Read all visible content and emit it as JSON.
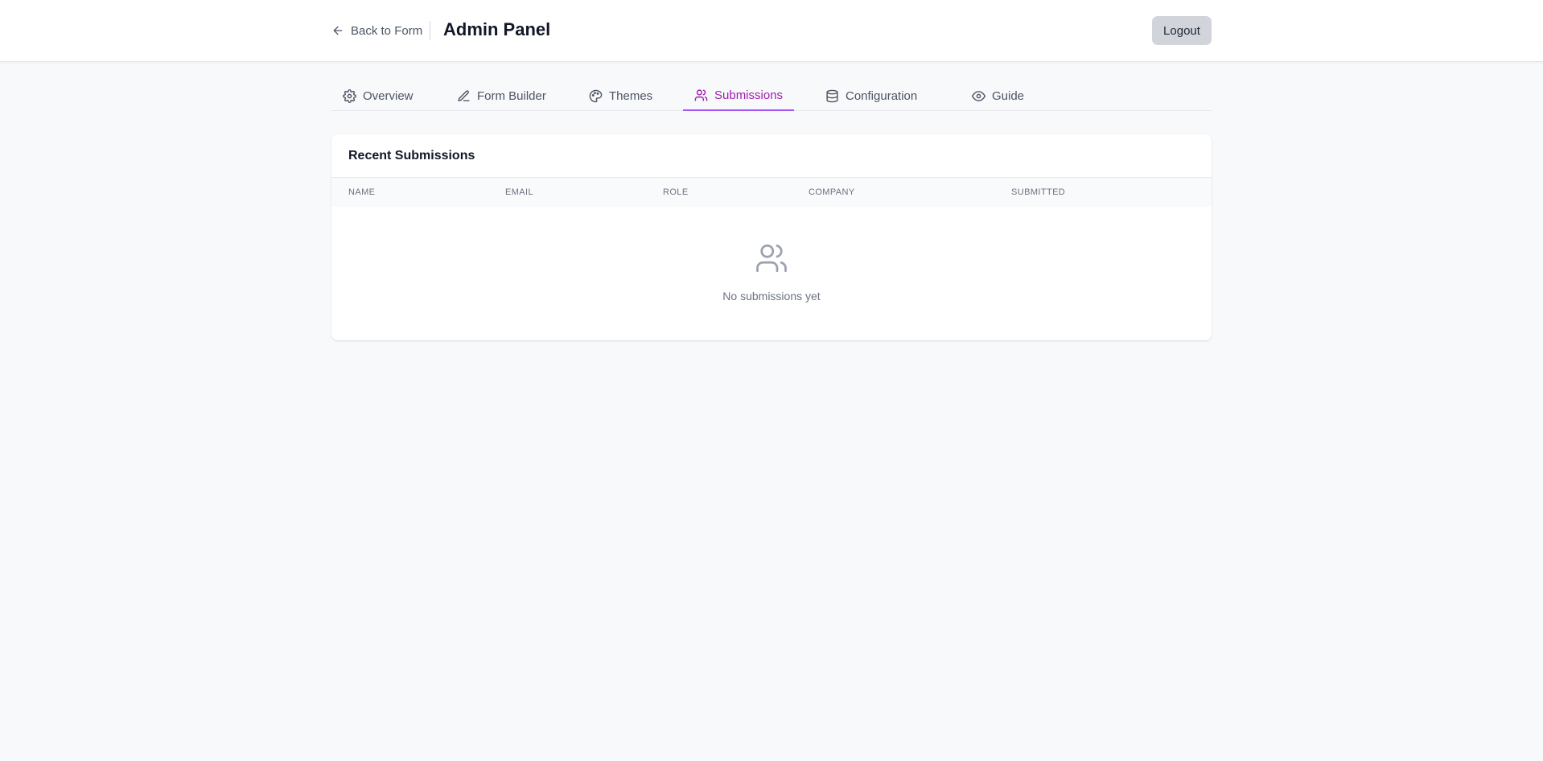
{
  "header": {
    "back_label": "Back to Form",
    "title": "Admin Panel",
    "logout_label": "Logout"
  },
  "tabs": [
    {
      "label": "Overview",
      "icon": "gear-icon"
    },
    {
      "label": "Form Builder",
      "icon": "pencil-icon"
    },
    {
      "label": "Themes",
      "icon": "palette-icon"
    },
    {
      "label": "Submissions",
      "icon": "users-icon",
      "active": true
    },
    {
      "label": "Configuration",
      "icon": "database-icon"
    },
    {
      "label": "Guide",
      "icon": "eye-icon"
    }
  ],
  "submissions": {
    "title": "Recent Submissions",
    "columns": [
      "Name",
      "Email",
      "Role",
      "Company",
      "Submitted"
    ],
    "empty_text": "No submissions yet",
    "empty_icon": "users-icon"
  },
  "colors": {
    "accent": "#a21caf",
    "accent_underline": "#a855f7",
    "background": "#f8f9fb"
  }
}
